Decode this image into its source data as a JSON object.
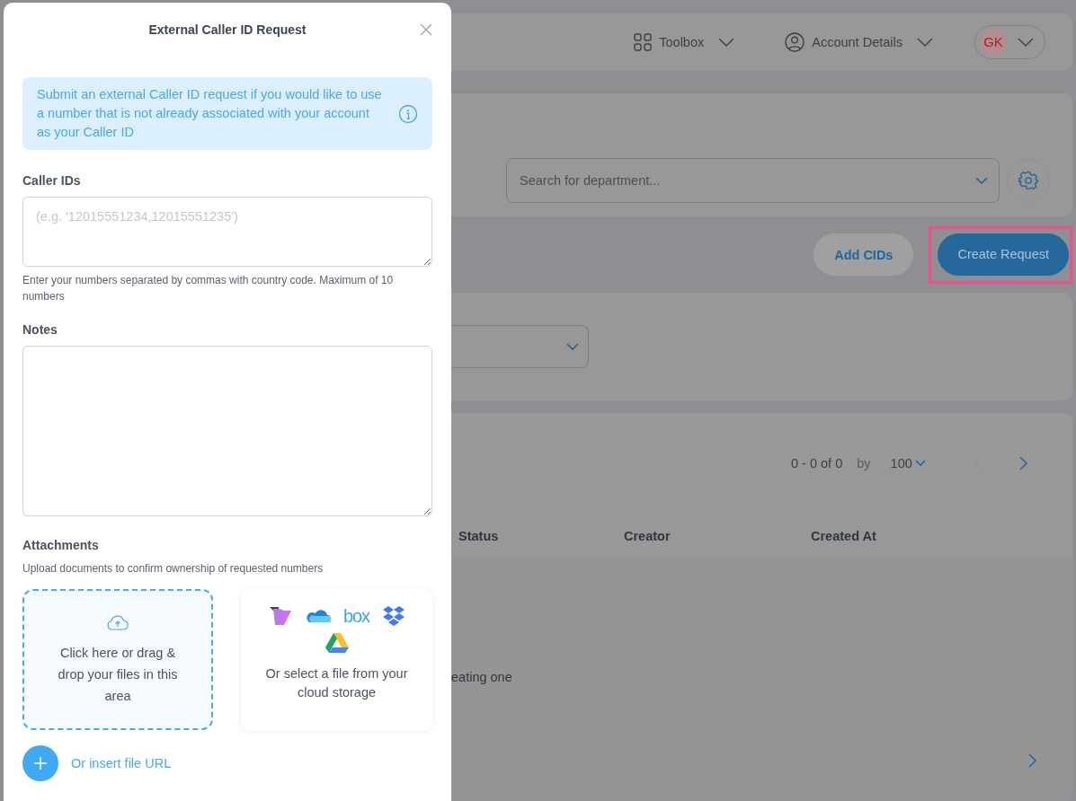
{
  "dialog": {
    "title": "External Caller ID Request",
    "info": "Submit an external Caller ID request if you would like to use a number that is not already associated with your account as your Caller ID",
    "caller_ids": {
      "label": "Caller IDs",
      "placeholder": "(e.g. '12015551234,12015551235')",
      "hint": "Enter your numbers separated by commas with country code. Maximum of 10 numbers"
    },
    "notes": {
      "label": "Notes"
    },
    "attachments": {
      "label": "Attachments",
      "hint": "Upload documents to confirm ownership of requested numbers",
      "dropzone": "Click here or drag & drop your files in this area",
      "box_logo": "box",
      "cloud": "Or select a file from your cloud storage",
      "url_link": "Or insert file URL"
    }
  },
  "header": {
    "toolbox": "Toolbox",
    "account": "Account Details",
    "avatar": "GK"
  },
  "department_search": {
    "placeholder": "Search for department..."
  },
  "actions": [
    {
      "label": "Add CIDs",
      "primary": false,
      "highlighted": false
    },
    {
      "label": "Create Request",
      "primary": true,
      "highlighted": true
    }
  ],
  "pagination": {
    "range": "0 - 0 of 0",
    "by": "by",
    "page_size": "100",
    "prev_disabled": true
  },
  "table": {
    "columns": [
      "Status",
      "Creator",
      "Created At"
    ],
    "empty_message": "eating one"
  }
}
